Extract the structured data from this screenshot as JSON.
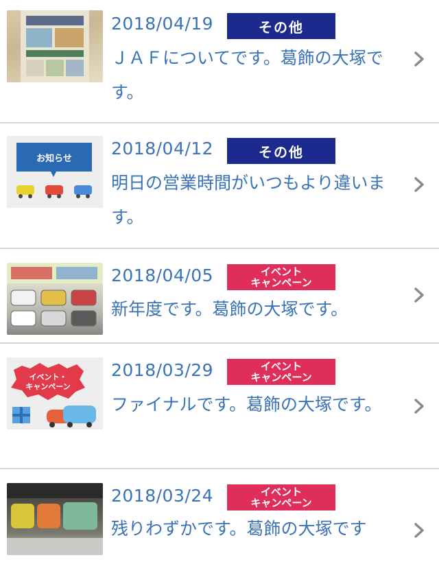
{
  "items": [
    {
      "date": "2018/04/19",
      "badge": {
        "type": "other",
        "label": "その他"
      },
      "title": "ＪＡＦについてです。葛飾の大塚です。",
      "thumb_icon": "photo-flyer"
    },
    {
      "date": "2018/04/12",
      "badge": {
        "type": "other",
        "label": "その他"
      },
      "title": "明日の営業時間がいつもより違います。",
      "thumb_icon": "notice-cars-illustration",
      "thumb_text": "お知らせ"
    },
    {
      "date": "2018/04/05",
      "badge": {
        "type": "event",
        "line1": "イベント",
        "line2": "キャンペーン"
      },
      "title": "新年度です。葛飾の大塚です。",
      "thumb_icon": "photo-car-flyer"
    },
    {
      "date": "2018/03/29",
      "badge": {
        "type": "event",
        "line1": "イベント",
        "line2": "キャンペーン"
      },
      "title": "ファイナルです。葛飾の大塚です。",
      "thumb_icon": "event-campaign-illustration",
      "thumb_text_1": "イベント・",
      "thumb_text_2": "キャンペーン"
    },
    {
      "date": "2018/03/24",
      "badge": {
        "type": "event",
        "line1": "イベント",
        "line2": "キャンペーン"
      },
      "title": "残りわずかです。葛飾の大塚です",
      "thumb_icon": "photo-parked-cars"
    }
  ],
  "colors": {
    "text_blue": "#3a73b5",
    "badge_other": "#1b2a8c",
    "badge_event": "#df2e5a",
    "divider": "#d6d6d6",
    "chevron": "#8a8a8a"
  }
}
